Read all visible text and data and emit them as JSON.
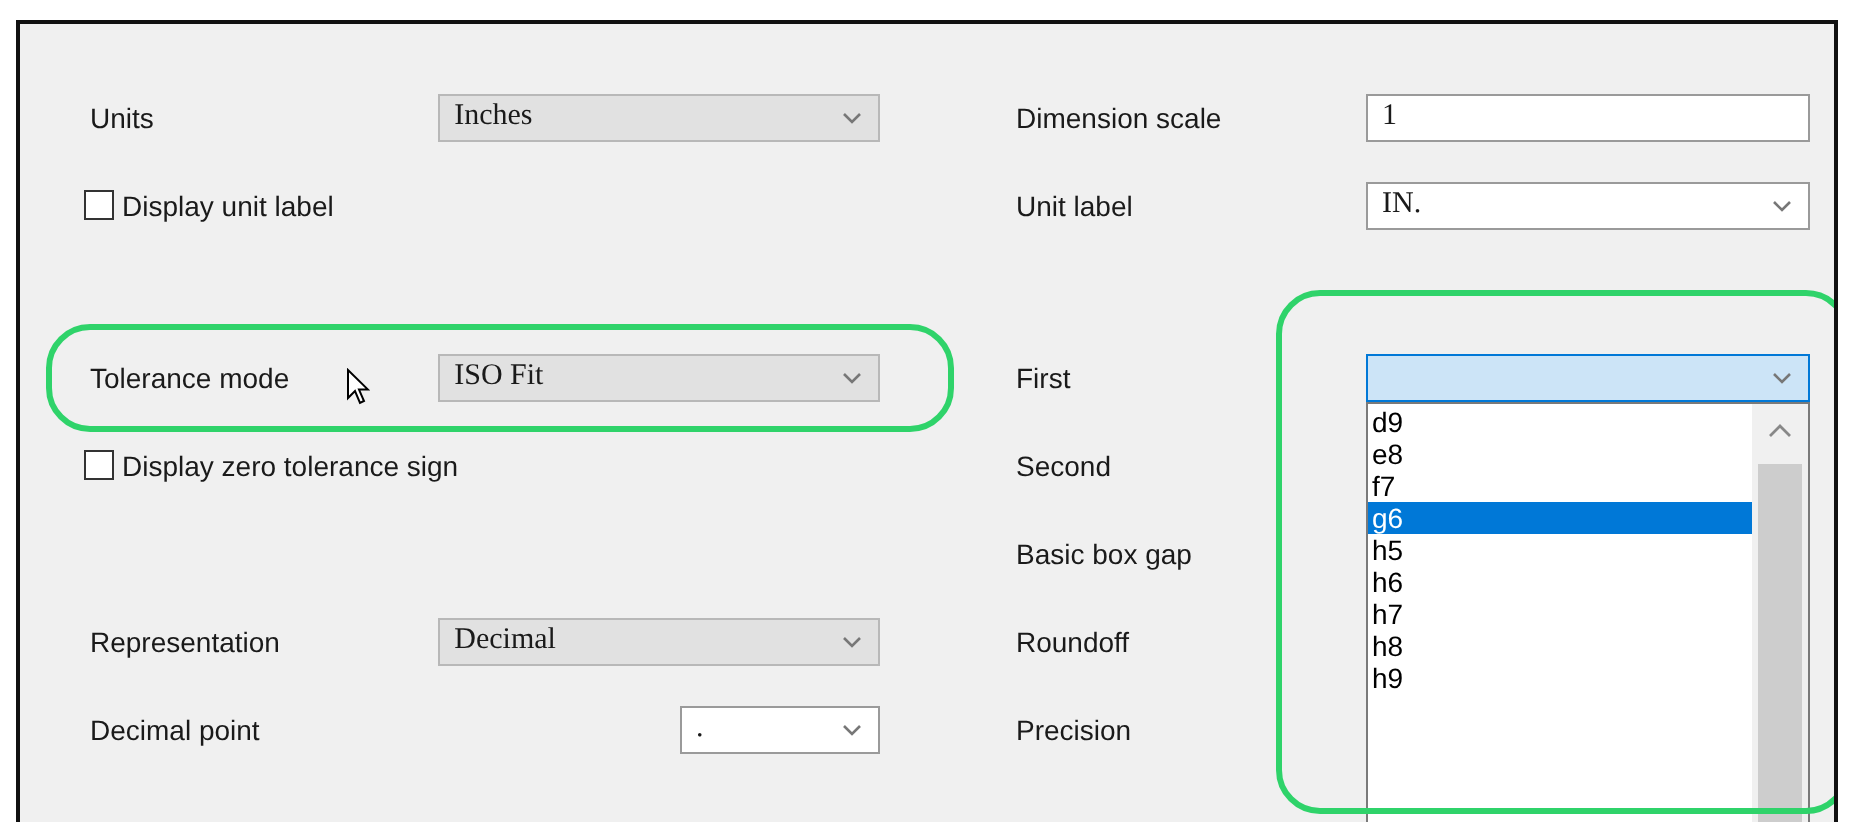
{
  "sections": [
    {
      "rows": [
        {
          "left": {
            "kind": "combo",
            "label": "Units",
            "value": "Inches"
          },
          "right": {
            "kind": "text",
            "label": "Dimension scale",
            "value": "1"
          }
        },
        {
          "left": {
            "kind": "checkbox",
            "label": "Display unit label",
            "checked": false
          },
          "right": {
            "kind": "edit-combo",
            "label": "Unit label",
            "value": "IN."
          }
        }
      ]
    },
    {
      "rows": [
        {
          "highlighted": true,
          "pointer_hover": true,
          "left": {
            "kind": "combo",
            "label": "Tolerance mode",
            "value": "ISO Fit"
          },
          "right": {
            "kind": "edit-combo",
            "label": "First",
            "expanded": true,
            "highlighted": true,
            "options": [
              {
                "label": "d9",
                "selected": false
              },
              {
                "label": "e8",
                "selected": false
              },
              {
                "label": "f7",
                "selected": false
              },
              {
                "label": "g6",
                "selected": true
              },
              {
                "label": "h5",
                "selected": false
              },
              {
                "label": "h6",
                "selected": false
              },
              {
                "label": "h7",
                "selected": false
              },
              {
                "label": "h8",
                "selected": false
              },
              {
                "label": "h9",
                "selected": false
              }
            ]
          }
        },
        {
          "left": {
            "kind": "checkbox",
            "label": "Display zero tolerance sign",
            "checked": false
          },
          "right": {
            "kind": "label",
            "label": "Second"
          }
        },
        {
          "right": {
            "kind": "label",
            "label": "Basic box gap"
          }
        },
        {
          "left": {
            "kind": "combo",
            "label": "Representation",
            "value": "Decimal"
          },
          "right": {
            "kind": "label",
            "label": "Roundoff"
          }
        },
        {
          "left": {
            "kind": "small-combo",
            "label": "Decimal point",
            "value": "."
          },
          "right": {
            "kind": "label",
            "label": "Precision"
          }
        }
      ]
    }
  ]
}
